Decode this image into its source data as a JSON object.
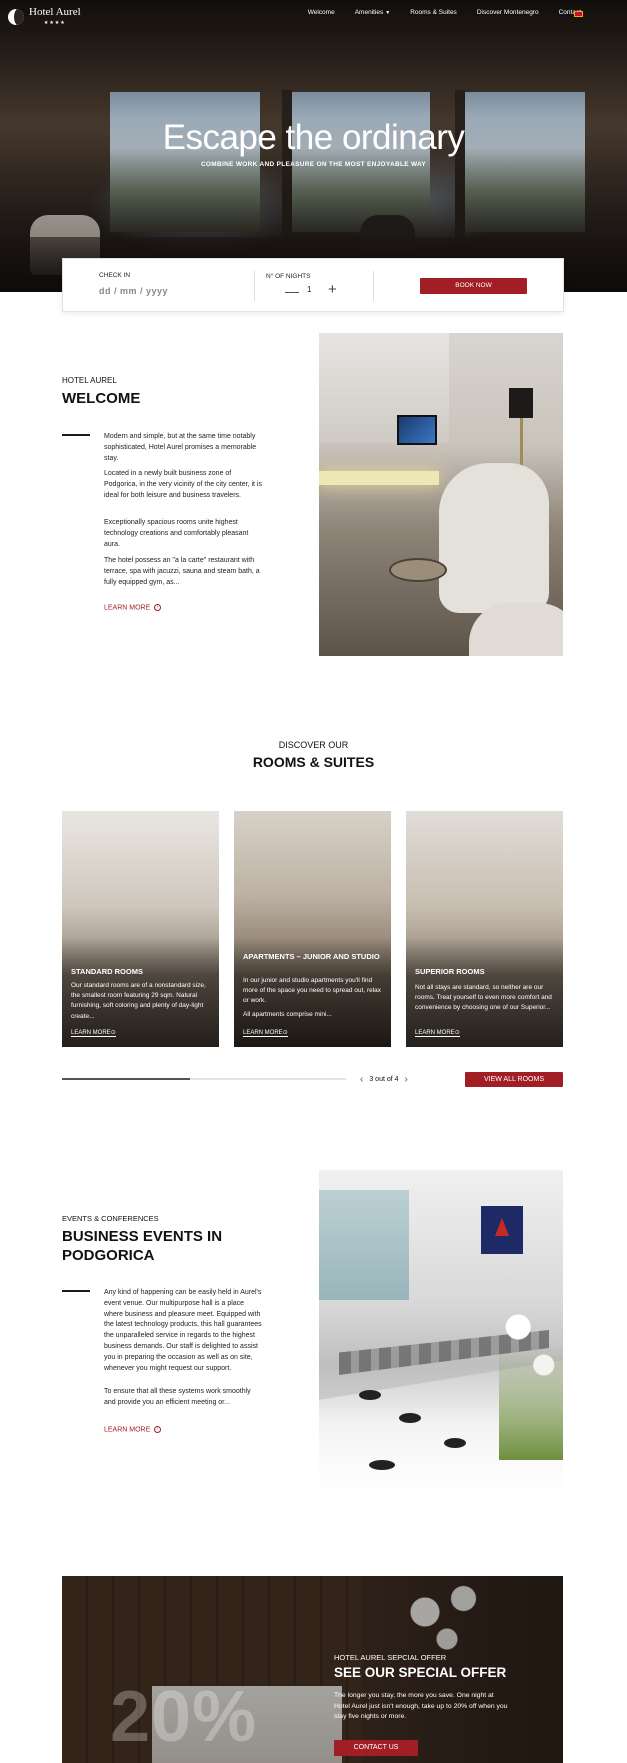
{
  "nav": {
    "logo_text": "Hotel Aurel",
    "logo_stars": "★★★★",
    "items": [
      {
        "label": "Welcome"
      },
      {
        "label": "Amenities",
        "has_dropdown": true
      },
      {
        "label": "Rooms & Suites"
      },
      {
        "label": "Discover Montenegro"
      },
      {
        "label": "Contact"
      }
    ],
    "language_flag": "montenegro-flag-icon"
  },
  "hero": {
    "title": "Escape the ordinary",
    "subtitle": "COMBINE WORK AND PLEASURE ON THE MOST ENJOYABLE WAY"
  },
  "booking": {
    "checkin_label": "CHECK IN",
    "checkin_placeholder": "dd / mm / yyyy",
    "nights_label": "N° OF NIGHTS",
    "nights_value": "1",
    "minus_symbol": "—",
    "plus_symbol": "+",
    "book_button": "BOOK NOW"
  },
  "welcome": {
    "eyebrow": "HOTEL AUREL",
    "title": "WELCOME",
    "paragraphs": [
      "Modern and simple, but at the same time notably sophisticated, Hotel Aurel promises a memorable stay.",
      "Located in a newly built business zone of Podgorica, in the very vicinity of the city center, it is ideal for both leisure and business travelers.",
      "Exceptionally spacious rooms unite highest technology creations and comfortably pleasant aura.",
      "The hotel possess an \"a la carte\" restaurant with terrace, spa with jacuzzi, sauna and steam bath, a fully equipped gym, as..."
    ],
    "learn_more": "LEARN MORE"
  },
  "rooms": {
    "eyebrow": "DISCOVER OUR",
    "title": "ROOMS & SUITES",
    "cards": [
      {
        "title": "STANDARD ROOMS",
        "text": "Our standard rooms are of a nonstandard size, the smallest room featuring 29 sqm. Natural furnishing, soft coloring and plenty of day-light create...",
        "link": "LEARN MORE"
      },
      {
        "title": "APARTMENTS – JUNIOR AND STUDIO",
        "text": "In our junior and studio apartments you'll find more of the space you need to spread out, relax or work.",
        "text2": "All apartments comprise mini...",
        "link": "LEARN MORE"
      },
      {
        "title": "SUPERIOR ROOMS",
        "text": "Not all stays are standard, so neither are our rooms. Treat yourself to even more comfort and convenience  by choosing one of our Superior...",
        "link": "LEARN MORE"
      }
    ],
    "slider_progress": 0.45,
    "pager_text": "3 out of 4",
    "view_all": "VIEW ALL ROOMS"
  },
  "events": {
    "eyebrow": "EVENTS & CONFERENCES",
    "title_line1": "BUSINESS EVENTS IN",
    "title_line2": "PODGORICA",
    "paragraphs": [
      "Any kind of happening can be easily held in Aurel's event venue. Our multipurpose hall is a place where business and pleasure meet. Equipped with the latest technology products, this hall guarantees the unparalleled service in regards to the highest business demands. Our staff is delighted to assist you in preparing the occasion as well as on site, whenever you might request our support.",
      "To ensure that all these systems work smoothly and provide you an efficient meeting or..."
    ],
    "learn_more": "LEARN MORE"
  },
  "offer": {
    "big_text": "20%",
    "eyebrow": "HOTEL AUREL SEPCIAL OFFER",
    "title": "SEE OUR SPECIAL OFFER",
    "text": "The longer you stay, the more you save. One night at Hotel Aurel just isn't enough, take up to 20% off when you stay five nights or more.",
    "button": "CONTACT US"
  },
  "colors": {
    "accent": "#a01e24",
    "text": "#111111"
  }
}
